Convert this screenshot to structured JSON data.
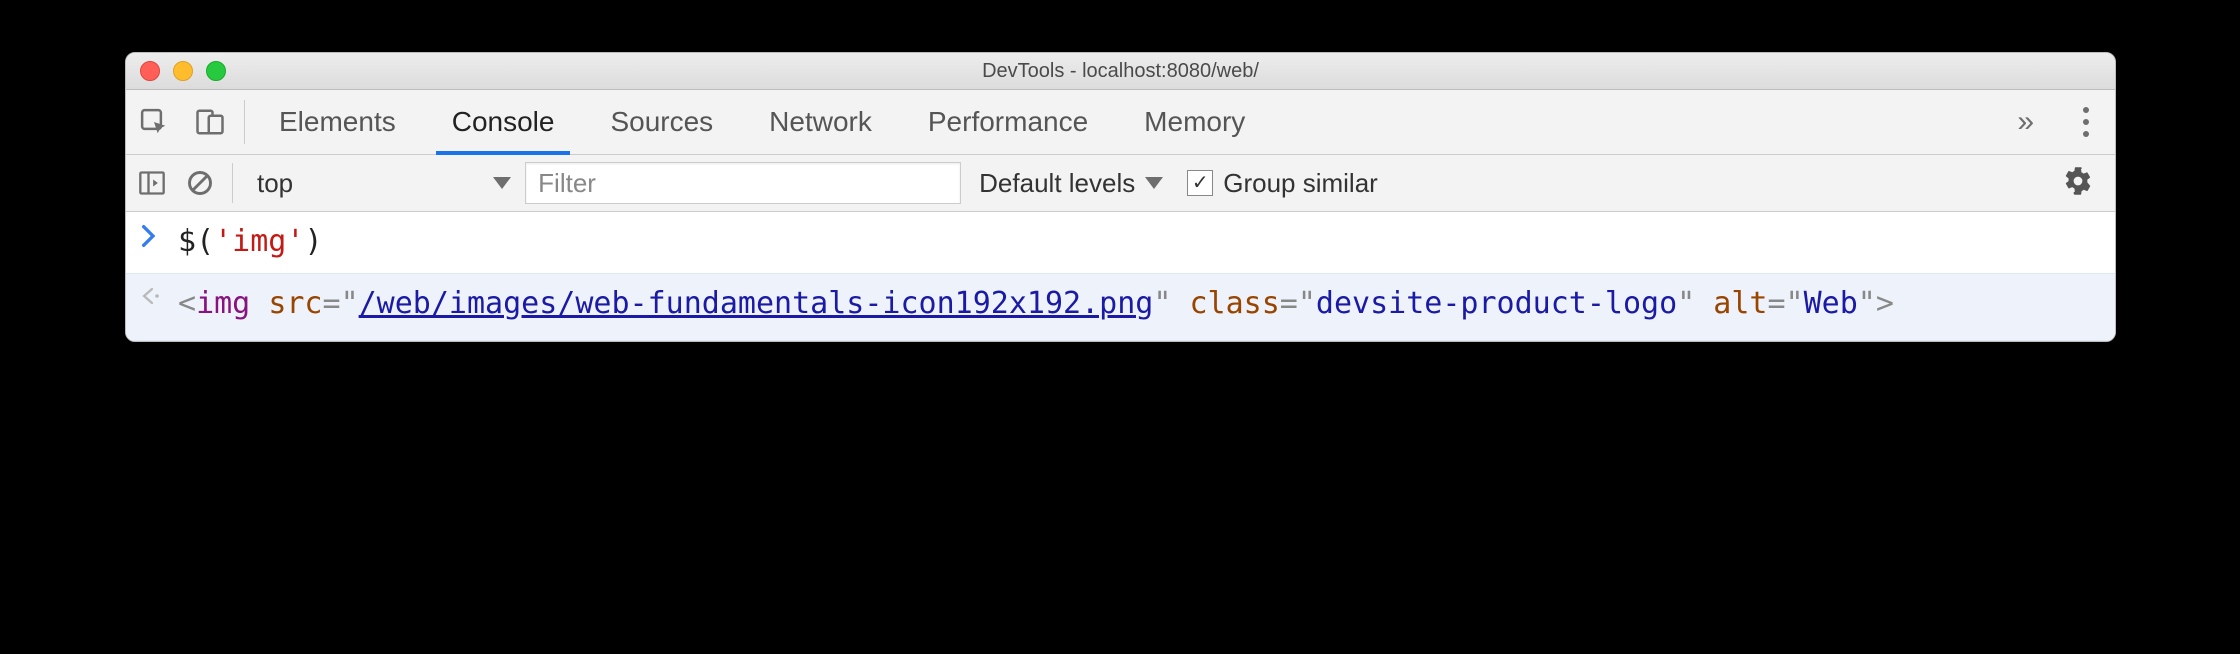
{
  "window": {
    "title": "DevTools - localhost:8080/web/"
  },
  "tabs": {
    "items": [
      "Elements",
      "Console",
      "Sources",
      "Network",
      "Performance",
      "Memory"
    ],
    "active_index": 1,
    "overflow_glyph": "»"
  },
  "toolbar": {
    "context": "top",
    "filter_placeholder": "Filter",
    "filter_value": "",
    "levels_label": "Default levels",
    "group_similar_label": "Group similar",
    "group_similar_checked": true
  },
  "console": {
    "input": {
      "fn": "$",
      "arg": "'img'"
    },
    "output": {
      "tag": "img",
      "attrs": [
        {
          "name": "src",
          "value": "/web/images/web-fundamentals-icon192x192.png",
          "link": true
        },
        {
          "name": "class",
          "value": "devsite-product-logo",
          "link": false
        },
        {
          "name": "alt",
          "value": "Web",
          "link": false
        }
      ]
    }
  }
}
